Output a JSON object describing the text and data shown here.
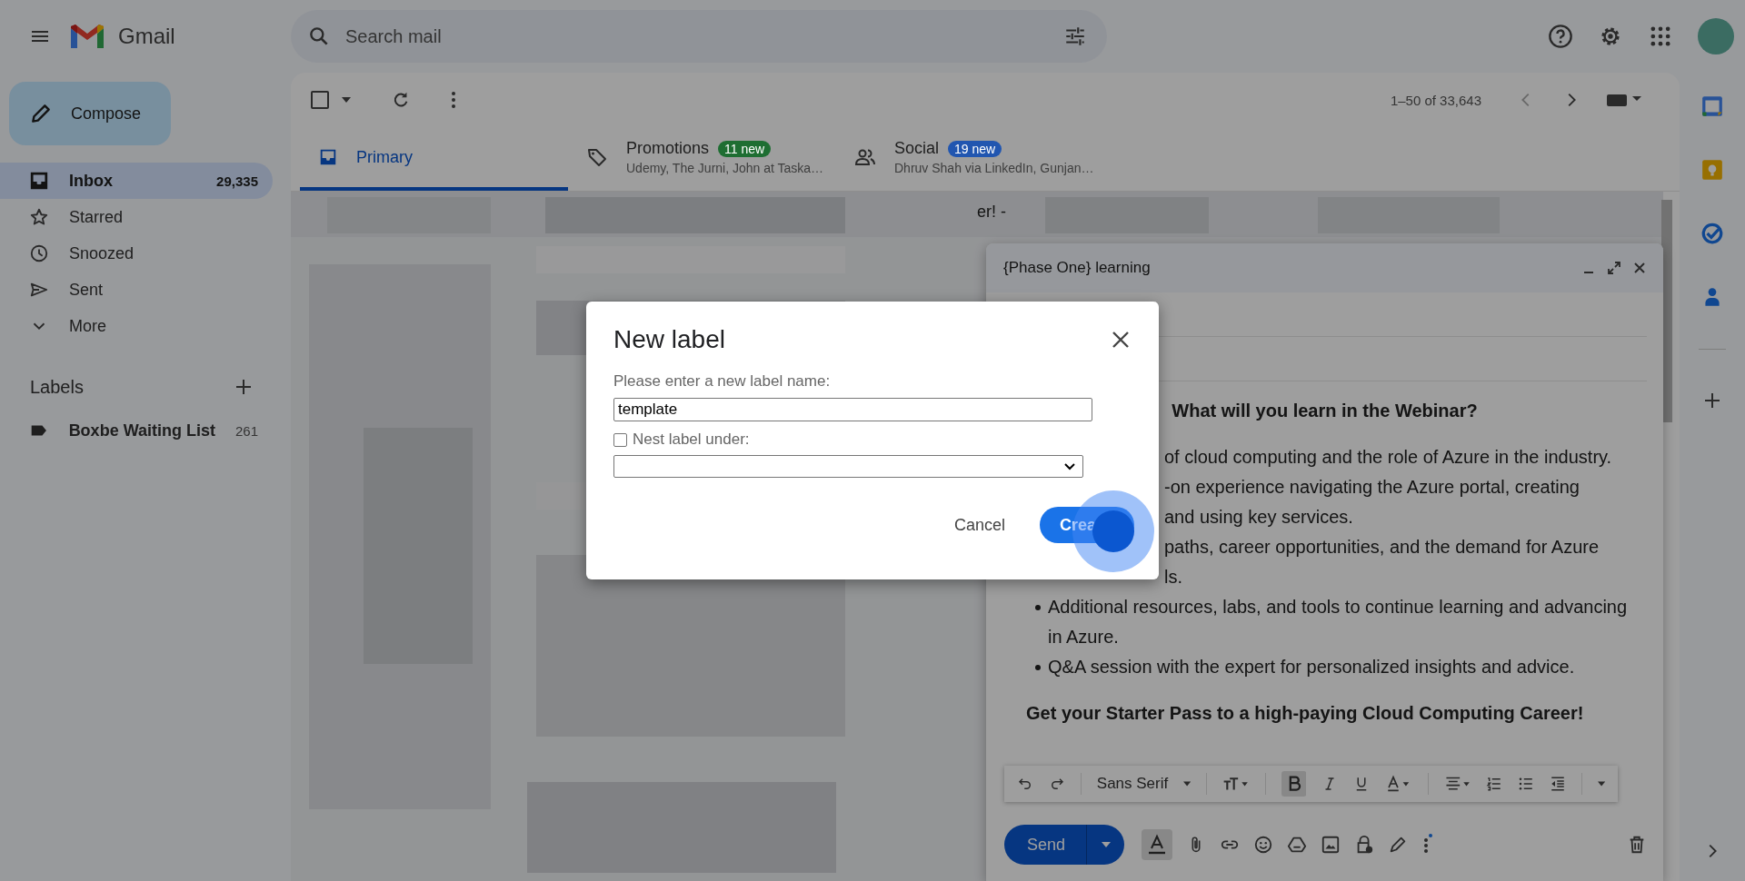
{
  "header": {
    "app_name": "Gmail",
    "search": {
      "placeholder": "Search mail"
    }
  },
  "sidebar": {
    "compose": "Compose",
    "items": [
      {
        "label": "Inbox",
        "count": "29,335",
        "selected": true
      },
      {
        "label": "Starred",
        "selected": false
      },
      {
        "label": "Snoozed",
        "selected": false
      },
      {
        "label": "Sent",
        "selected": false
      },
      {
        "label": "More",
        "selected": false
      }
    ],
    "labels_heading": "Labels",
    "labels": [
      {
        "label": "Boxbe Waiting List",
        "count": "261"
      }
    ]
  },
  "toolbar": {
    "select_all": false,
    "range": "1–50 of 33,643"
  },
  "tabs": [
    {
      "label": "Primary",
      "selected": true
    },
    {
      "label": "Promotions",
      "badge": "11 new",
      "color": "#1e6e32",
      "senders": "Udemy, The Jurni, John at Taska…",
      "selected": false
    },
    {
      "label": "Social",
      "badge": "19 new",
      "color": "#2156b0",
      "senders": "Dhruv Shah via LinkedIn, Gunjan…",
      "selected": false
    }
  ],
  "email_list": {
    "visible_fragment": "er! -"
  },
  "compose": {
    "title": "{Phase One} learning",
    "heading": "What will you learn in the Webinar?",
    "lines": [
      {
        "kind": "fragment",
        "text": "of cloud computing and the role of Azure in the industry."
      },
      {
        "kind": "fragment",
        "text": "-on experience navigating the Azure portal, creating"
      },
      {
        "kind": "fragment",
        "text": "and using key services."
      },
      {
        "kind": "fragment",
        "text": "paths, career opportunities, and the demand for Azure"
      },
      {
        "kind": "fragment",
        "text": "ls."
      },
      {
        "kind": "bullet",
        "text": "Additional resources, labs, and tools to continue learning and advancing in Azure."
      },
      {
        "kind": "bullet",
        "text": "Q&A session with the expert for personalized insights and advice."
      }
    ],
    "closing": "Get your Starter Pass to a high-paying Cloud Computing Career!",
    "format_toolbar": {
      "font": "Sans Serif",
      "bold": true
    },
    "formatting_open": true,
    "send": "Send"
  },
  "dialog": {
    "title": "New label",
    "prompt": "Please enter a new label name:",
    "value": "template",
    "nest": {
      "label": "Nest label under:",
      "checked": false
    },
    "buttons": [
      {
        "label": "Cancel",
        "kind": "text"
      },
      {
        "label": "Crea",
        "kind": "primary"
      }
    ]
  }
}
